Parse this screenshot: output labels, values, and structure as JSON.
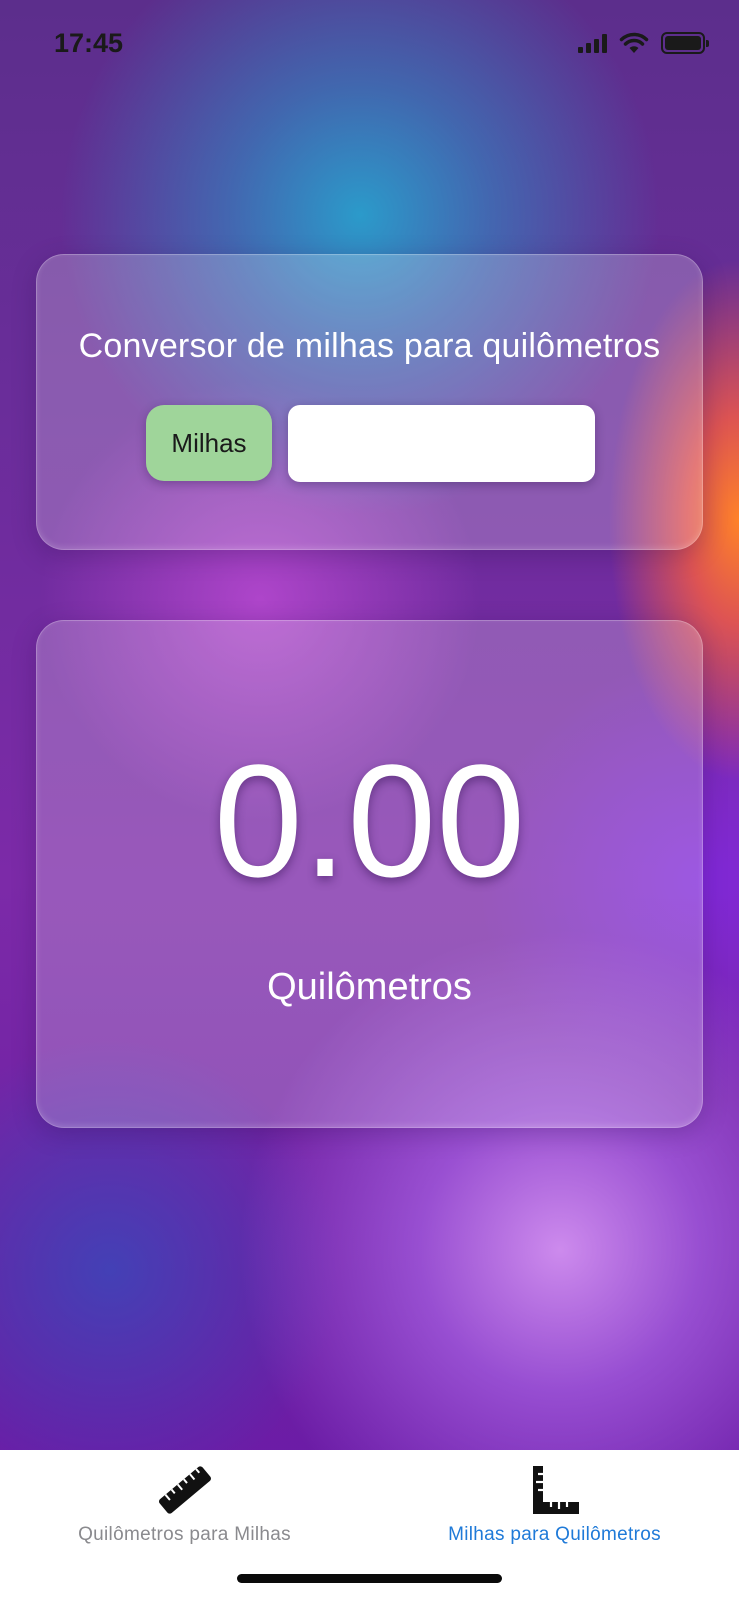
{
  "status_bar": {
    "time": "17:45",
    "icons": [
      "cellular-signal-icon",
      "wifi-icon",
      "battery-icon"
    ]
  },
  "converter": {
    "title": "Conversor de milhas para quilômetros",
    "unit_label": "Milhas",
    "input_value": "",
    "input_placeholder": "",
    "unit_label_color": "#9fd59a"
  },
  "result": {
    "value": "0.00",
    "unit": "Quilômetros"
  },
  "tab_bar": {
    "tabs": [
      {
        "label": "Quilômetros para Milhas",
        "icon": "ruler-icon",
        "selected": false
      },
      {
        "label": "Milhas para Quilômetros",
        "icon": "square-ruler-icon",
        "selected": true
      }
    ],
    "selected_color": "#1f7ad8",
    "unselected_color": "#8a8a8e"
  }
}
